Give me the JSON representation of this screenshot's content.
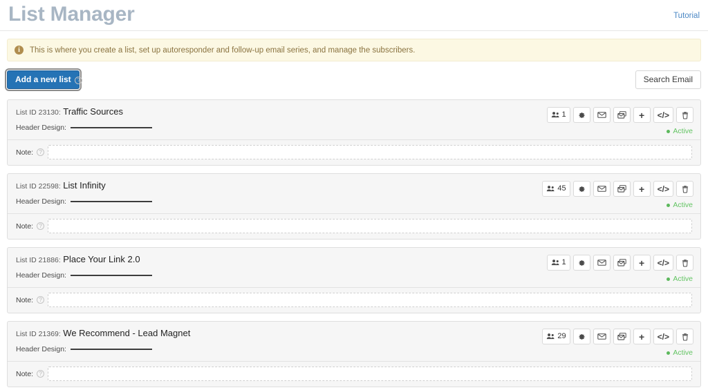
{
  "header": {
    "title": "List Manager",
    "tutorial_label": "Tutorial"
  },
  "banner": {
    "icon": "info-icon",
    "text": "This is where you create a list, set up autoresponder and follow-up email series, and manage the subscribers."
  },
  "toolbar": {
    "add_list_label": "Add a new list",
    "add_list_help_icon": "help-icon",
    "search_email_label": "Search Email"
  },
  "card_labels": {
    "list_id_prefix": "List ID",
    "header_design_label": "Header Design:",
    "note_label": "Note:",
    "note_help_icon": "help-icon",
    "note_placeholder": "",
    "status_active": "Active"
  },
  "action_icons": [
    {
      "name": "subscribers-icon",
      "title": "Subscribers"
    },
    {
      "name": "gear-icon",
      "title": "Settings"
    },
    {
      "name": "envelope-icon",
      "title": "Email"
    },
    {
      "name": "envelope-series-icon",
      "title": "Email series"
    },
    {
      "name": "plus-icon",
      "title": "Add",
      "glyph": "+"
    },
    {
      "name": "code-icon",
      "title": "Code",
      "glyph": "</>"
    },
    {
      "name": "trash-icon",
      "title": "Delete"
    }
  ],
  "colors": {
    "title": "#a8b6c4",
    "link": "#4a87c4",
    "banner_bg": "#fcf8e3",
    "banner_text": "#8a7340",
    "primary_button": "#2573b5",
    "status_active": "#5cb85c",
    "card_bg": "#f6f6f6"
  },
  "lists": [
    {
      "list_id": "23130",
      "name": "Traffic Sources",
      "subscribers": "1",
      "status": "Active",
      "note_value": ""
    },
    {
      "list_id": "22598",
      "name": "List Infinity",
      "subscribers": "45",
      "status": "Active",
      "note_value": ""
    },
    {
      "list_id": "21886",
      "name": "Place Your Link 2.0",
      "subscribers": "1",
      "status": "Active",
      "note_value": ""
    },
    {
      "list_id": "21369",
      "name": "We Recommend - Lead Magnet",
      "subscribers": "29",
      "status": "Active",
      "note_value": ""
    }
  ]
}
